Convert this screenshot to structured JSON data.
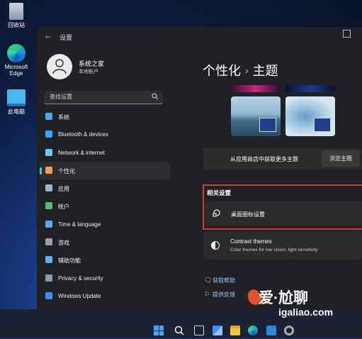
{
  "desktop": {
    "icons": [
      {
        "label": "回收站",
        "icon": "recycle-bin-icon"
      },
      {
        "label": "Microsoft Edge",
        "icon": "edge-icon"
      },
      {
        "label": "此电脑",
        "icon": "this-pc-icon"
      }
    ]
  },
  "window": {
    "title": "设置",
    "profile": {
      "name": "系统之家",
      "sub": "本地帐户"
    },
    "search": {
      "placeholder": "查找设置"
    },
    "nav": [
      {
        "label": "系统",
        "icon": "display-icon",
        "color": "#4aa8ff"
      },
      {
        "label": "Bluetooth & devices",
        "icon": "bluetooth-icon",
        "color": "#3da3ff"
      },
      {
        "label": "Network & internet",
        "icon": "wifi-icon",
        "color": "#6cc8ff"
      },
      {
        "label": "个性化",
        "icon": "brush-icon",
        "color": "#f0a050",
        "active": true
      },
      {
        "label": "应用",
        "icon": "apps-icon",
        "color": "#9ab4d6"
      },
      {
        "label": "帐户",
        "icon": "account-icon",
        "color": "#4bc07a"
      },
      {
        "label": "Time & language",
        "icon": "globe-clock-icon",
        "color": "#58a8ff"
      },
      {
        "label": "游戏",
        "icon": "gamepad-icon",
        "color": "#a0a0a0"
      },
      {
        "label": "辅助功能",
        "icon": "accessibility-icon",
        "color": "#5ab0ff"
      },
      {
        "label": "Privacy & security",
        "icon": "shield-icon",
        "color": "#8a9ab0"
      },
      {
        "label": "Windows Update",
        "icon": "update-icon",
        "color": "#3d8fff"
      }
    ],
    "main": {
      "breadcrumb_parent": "个性化",
      "breadcrumb_sep": "›",
      "breadcrumb_current": "主题",
      "store_row": {
        "label": "从应用商店中获取更多主题",
        "button": "浏览主题"
      },
      "related": {
        "heading": "相关设置",
        "desktop_icons": "桌面图标设置"
      },
      "contrast": {
        "title": "Contrast themes",
        "desc": "Color themes for low vision, light sensitivity"
      },
      "links": [
        {
          "label": "获取帮助",
          "icon": "help-icon"
        },
        {
          "label": "提供反馈",
          "icon": "feedback-icon"
        }
      ]
    }
  },
  "watermark": {
    "line1": "爱·尬聊",
    "line2": "igaliao.com"
  },
  "colors": {
    "accent": "#4cc2ff",
    "highlight_border": "#d6383d"
  }
}
